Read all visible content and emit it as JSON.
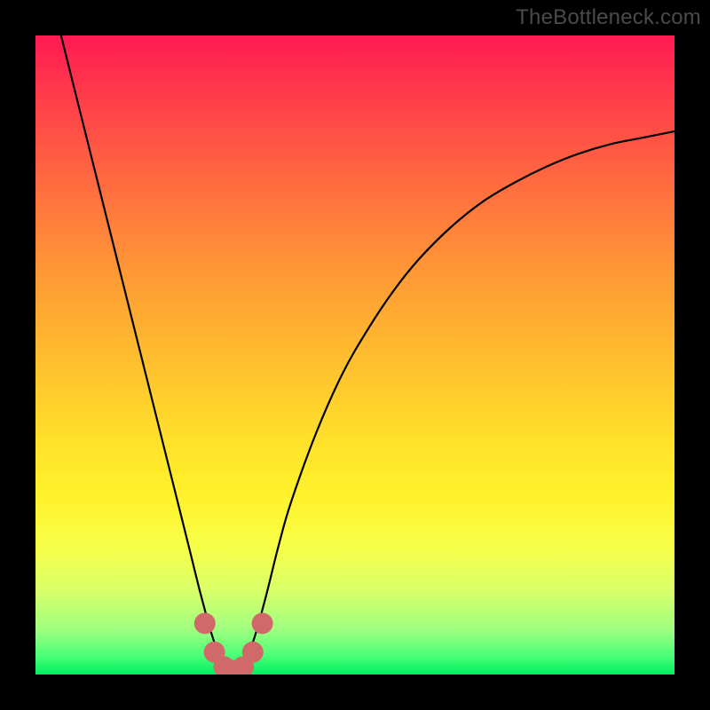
{
  "watermark": "TheBottleneck.com",
  "colors": {
    "curve_stroke": "#000000",
    "marker_fill": "#d06a6a",
    "marker_stroke": "#c45a5a",
    "gradient_top": "#ff1a53",
    "gradient_bottom": "#00f060",
    "frame": "#000000"
  },
  "chart_data": {
    "type": "line",
    "title": "",
    "xlabel": "",
    "ylabel": "",
    "xlim": [
      0,
      100
    ],
    "ylim": [
      0,
      100
    ],
    "grid": false,
    "legend": false,
    "note": "Axes unlabeled; values are in percent of plot area. y=0 at bottom, y=100 at top. Curve dips to ~0 near x≈31 and rises on both sides.",
    "series": [
      {
        "name": "bottleneck-curve",
        "x": [
          4,
          6,
          8,
          10,
          12,
          14,
          16,
          18,
          20,
          22,
          24,
          26,
          28,
          30,
          32,
          34,
          36,
          38,
          40,
          44,
          48,
          52,
          56,
          60,
          65,
          70,
          75,
          80,
          85,
          90,
          95,
          100
        ],
        "y": [
          100,
          92,
          84,
          76,
          68,
          60,
          52,
          44,
          36,
          28,
          20,
          12,
          5,
          1,
          1,
          5,
          12,
          20,
          27,
          38,
          47,
          54,
          60,
          65,
          70,
          74,
          77,
          79.5,
          81.5,
          83,
          84,
          85
        ]
      },
      {
        "name": "highlight-markers",
        "x": [
          26.5,
          28,
          29.5,
          31,
          32.5,
          34,
          35.5
        ],
        "y": [
          8,
          3.5,
          1.2,
          0.6,
          1.2,
          3.5,
          8
        ]
      }
    ]
  }
}
